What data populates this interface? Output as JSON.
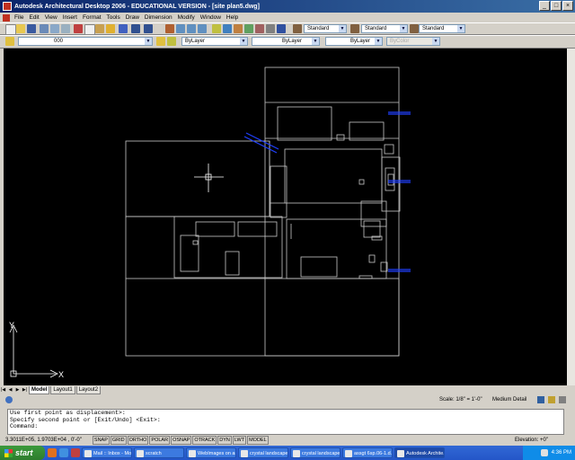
{
  "window": {
    "title": "Autodesk Architectural Desktop 2006 - EDUCATIONAL VERSION - [site plan5.dwg]",
    "min": "_",
    "max": "□",
    "close": "×"
  },
  "menu": [
    "File",
    "Edit",
    "View",
    "Insert",
    "Format",
    "Tools",
    "Draw",
    "Dimension",
    "Modify",
    "Window",
    "Help"
  ],
  "styles": {
    "text_style": "Standard",
    "dim_style": "Standard",
    "table_style": "Standard"
  },
  "layers": {
    "current": "000",
    "color": "ByLayer",
    "linetype": "ByLayer",
    "lineweight": "ByLayer",
    "plotstyle": "ByColor"
  },
  "layout_tabs": [
    "Model",
    "Layout1",
    "Layout2"
  ],
  "status_view": {
    "scale_label": "Scale: 1/8\" = 1'-0\"",
    "detail": "Medium Detail"
  },
  "command": {
    "lines": [
      "Use first point as displacement>:",
      "Specify second point or [Exit/Undo] <Exit>:",
      "Command:"
    ]
  },
  "statusbar": {
    "coords": "3.3011E+05, 1.9703E+04 , 0'-0\"",
    "buttons": [
      "SNAP",
      "GRID",
      "ORTHO",
      "POLAR",
      "OSNAP",
      "OTRACK",
      "DYN",
      "LWT",
      "MODEL"
    ],
    "elevation": "Elevation: +0\""
  },
  "ucs": {
    "x": "X",
    "y": "Y"
  },
  "taskbar": {
    "start": "start",
    "tasks": [
      "Mail :: Inbox - Mo...",
      "scratch",
      "WebImages on ar...",
      "crystal landscape...",
      "crystal landscape...",
      "assgt 6sp.06-1.d...",
      "Autodesk Archite..."
    ],
    "clock": "4:36 PM"
  },
  "colors": {
    "titlebar": "#0a246a",
    "canvas": "#000000",
    "taskbar": "#2456c8",
    "start": "#2e7d2e"
  }
}
